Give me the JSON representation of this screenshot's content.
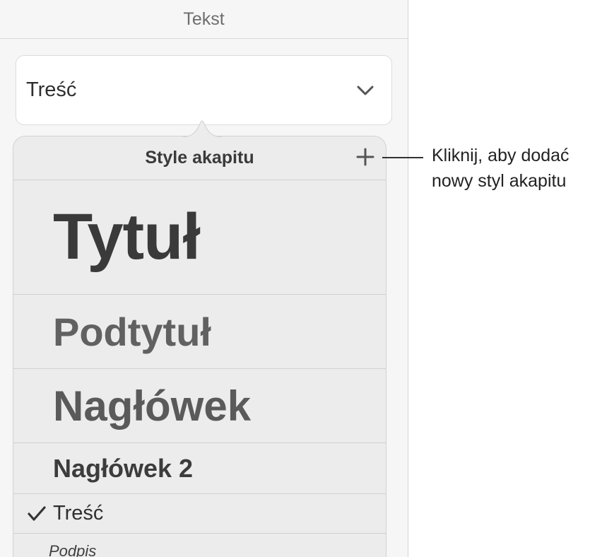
{
  "panel": {
    "header_title": "Tekst",
    "style_select": {
      "value": "Treść",
      "icon": "chevron-down-icon"
    }
  },
  "popover": {
    "title": "Style akapitu",
    "add_icon": "plus-icon",
    "items": [
      {
        "label": "Tytuł",
        "selected": false
      },
      {
        "label": "Podtytuł",
        "selected": false
      },
      {
        "label": "Nagłówek",
        "selected": false
      },
      {
        "label": "Nagłówek 2",
        "selected": false
      },
      {
        "label": "Treść",
        "selected": true
      },
      {
        "label": "Podpis",
        "selected": false
      }
    ],
    "selected_icon": "checkmark-icon"
  },
  "callout": {
    "line1": "Kliknij, aby dodać",
    "line2": "nowy styl akapitu"
  },
  "colors": {
    "panel_bg": "#f6f6f6",
    "popover_bg": "#ececec",
    "divider": "#d0d0d0",
    "text_dark": "#333333"
  }
}
